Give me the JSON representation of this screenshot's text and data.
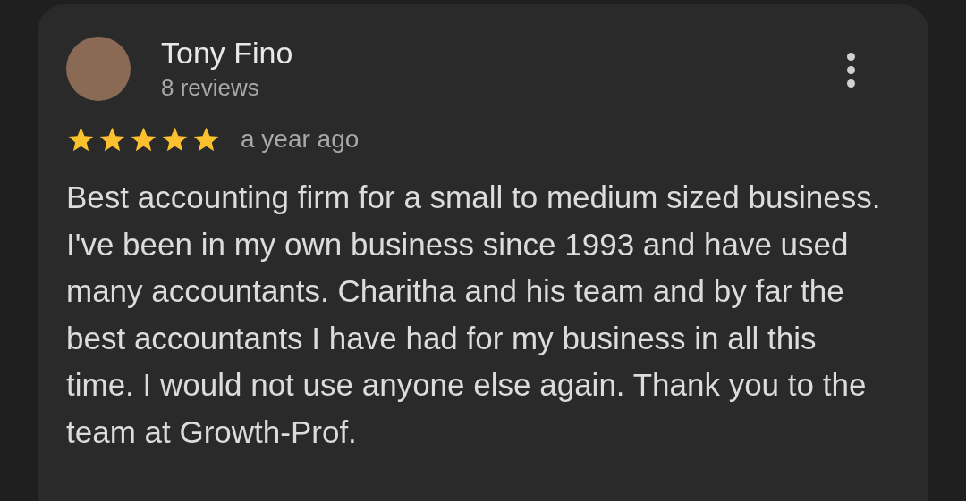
{
  "review": {
    "author": "Tony Fino",
    "review_count": "8 reviews",
    "stars": 5,
    "time": "a year ago",
    "text": "Best accounting firm for a small to medium sized business. I've been in my own business since 1993 and have used many accountants. Charitha and his team and by far the best accountants I have had for my business in all this time. I would not use anyone else again. Thank you to the team at Growth-Prof."
  }
}
